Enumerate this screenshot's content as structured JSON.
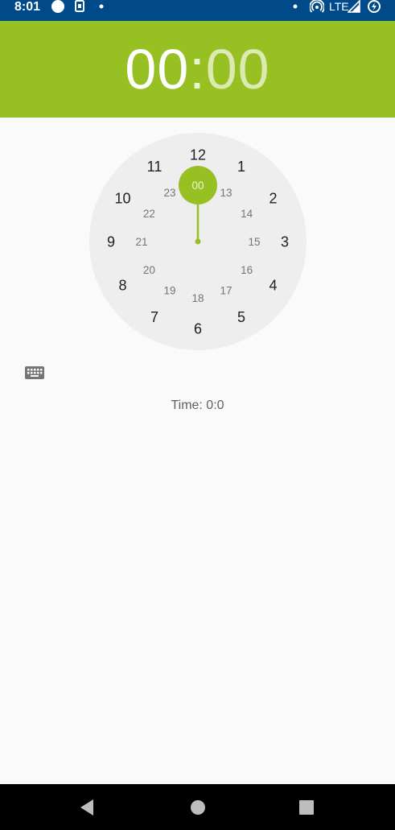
{
  "status_bar": {
    "time": "8:01",
    "network_label": "LTE",
    "icons": [
      "circle-notification-icon",
      "sim-card-icon",
      "dot-icon",
      "dot-icon",
      "hotspot-icon",
      "signal-icon",
      "battery-charging-icon"
    ]
  },
  "header": {
    "hours": "00",
    "separator": ":",
    "minutes": "00",
    "accent_color": "#97C023"
  },
  "clock": {
    "selected_value": "00",
    "outer_labels": [
      "12",
      "1",
      "2",
      "3",
      "4",
      "5",
      "6",
      "7",
      "8",
      "9",
      "10",
      "11"
    ],
    "inner_labels": [
      "00",
      "13",
      "14",
      "15",
      "16",
      "17",
      "18",
      "19",
      "20",
      "21",
      "22",
      "23"
    ]
  },
  "input_mode": {
    "icon": "keyboard-icon"
  },
  "result": {
    "text": "Time: 0:0"
  },
  "nav_bar": {
    "icons": [
      "back-icon",
      "home-icon",
      "recents-icon"
    ]
  }
}
